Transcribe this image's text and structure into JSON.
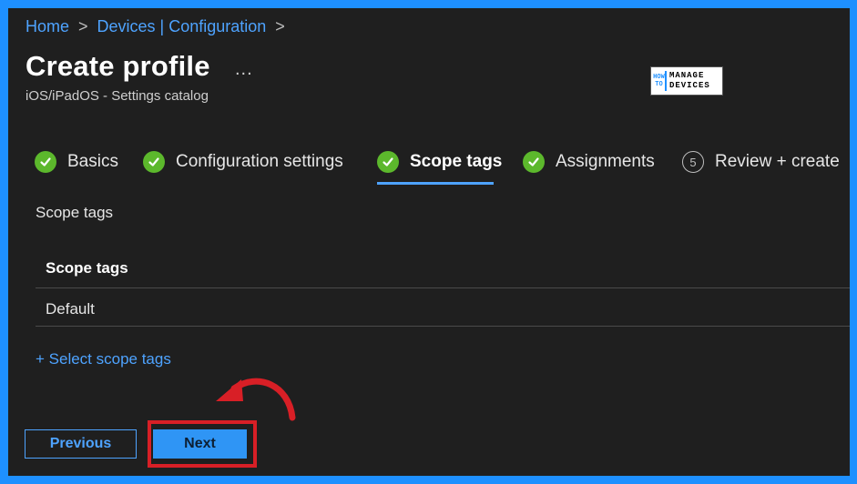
{
  "breadcrumb": {
    "items": [
      "Home",
      "Devices | Configuration"
    ],
    "separator": ">"
  },
  "header": {
    "title": "Create profile",
    "more": "...",
    "subtitle": "iOS/iPadOS - Settings catalog"
  },
  "logo": {
    "text_left": "HOW TO",
    "text_right": "MANAGE DEVICES"
  },
  "steps": [
    {
      "label": "Basics",
      "state": "done"
    },
    {
      "label": "Configuration settings",
      "state": "done"
    },
    {
      "label": "Scope tags",
      "state": "done",
      "active": true
    },
    {
      "label": "Assignments",
      "state": "done"
    },
    {
      "label": "Review + create",
      "state": "pending",
      "number": "5"
    }
  ],
  "scope": {
    "section_label": "Scope tags",
    "table_header": "Scope tags",
    "rows": [
      "Default"
    ],
    "select_link": "+ Select scope tags"
  },
  "buttons": {
    "previous": "Previous",
    "next": "Next"
  },
  "colors": {
    "background": "#1f1f1f",
    "frame_border": "#1e90ff",
    "link": "#4ea3ff",
    "check_green": "#5cb82c",
    "primary_button": "#2f95f5",
    "annotation_red": "#d81f26"
  }
}
